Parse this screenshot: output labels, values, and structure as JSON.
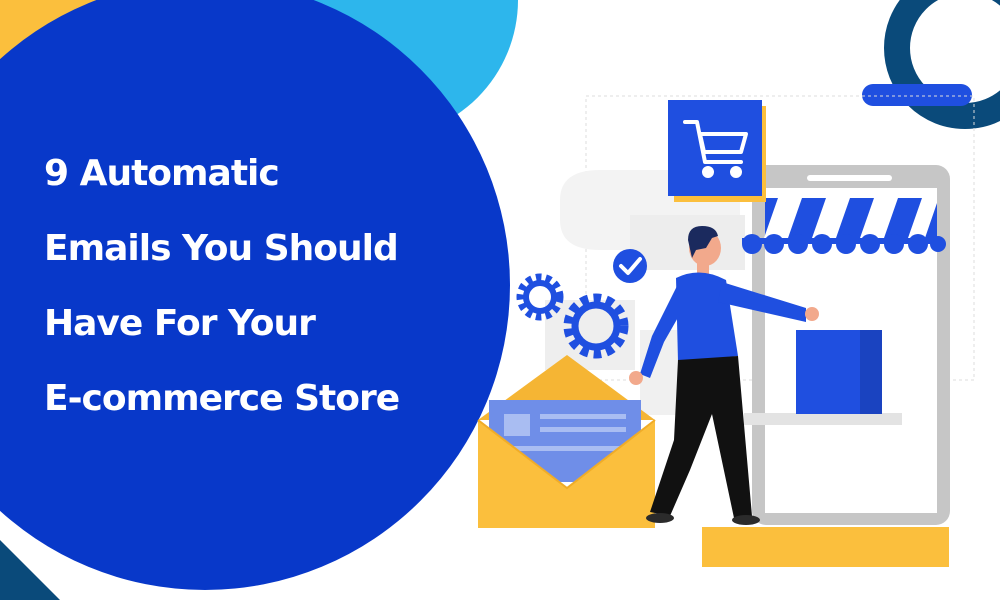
{
  "headline": {
    "lines": [
      "9 Automatic",
      "Emails You Should",
      "Have For Your",
      "E-commerce Store"
    ]
  },
  "colors": {
    "brand_blue": "#0838c9",
    "accent_blue": "#1f4fe0",
    "sky_blue": "#2db6ec",
    "yellow": "#fbbf3d",
    "navy": "#0a4a7a",
    "phone_gray": "#c6c6c6",
    "skin": "#f2a98c",
    "envelope_letter": "#6f8ee8"
  },
  "icons": [
    "shopping-cart-icon",
    "checkmark-icon",
    "gear-icon",
    "envelope-icon",
    "shopping-bag-icon"
  ]
}
